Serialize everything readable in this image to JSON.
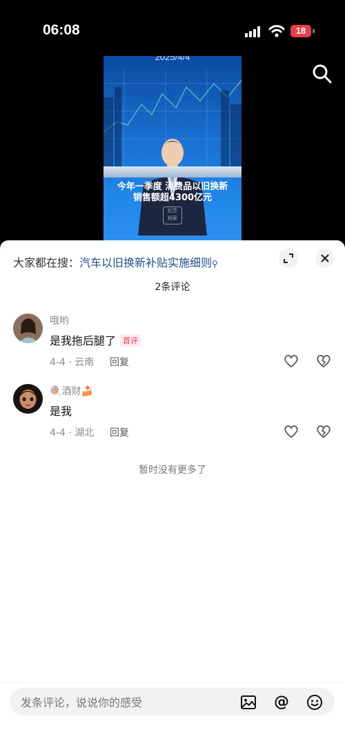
{
  "status_bar": {
    "time": "06:08",
    "battery": "18"
  },
  "video": {
    "date": "2025/4/4",
    "caption_line1": "今年一季度 消费品以旧换新",
    "caption_line2": "销售额超4300亿元",
    "logo_line1": "纪念",
    "logo_line2": "档案"
  },
  "sheet": {
    "search_prefix": "大家都在搜：",
    "search_topic": "汽车以旧换新补贴实施细则",
    "comment_count": "2条评论",
    "no_more": "暂时没有更多了"
  },
  "comments": [
    {
      "username": "哦哟",
      "text": "是我拖后腿了",
      "badge": "首评",
      "meta": "4-4 · 云南",
      "reply": "回复"
    },
    {
      "username_prefix": "🍭",
      "username": "酒财",
      "username_suffix": "🍰",
      "text": "是我",
      "meta": "4-4 · 湖北",
      "reply": "回复"
    }
  ],
  "input": {
    "placeholder": "发条评论，说说你的感受",
    "at_label": "@"
  },
  "colors": {
    "accent": "#e8334a",
    "topic": "#1f4e8c",
    "battery": "#e8404a"
  },
  "icons": [
    "signal-icon",
    "wifi-icon",
    "battery-icon",
    "search-icon",
    "expand-icon",
    "close-icon",
    "like-icon",
    "dislike-icon",
    "image-icon",
    "at-icon",
    "emoji-icon"
  ]
}
